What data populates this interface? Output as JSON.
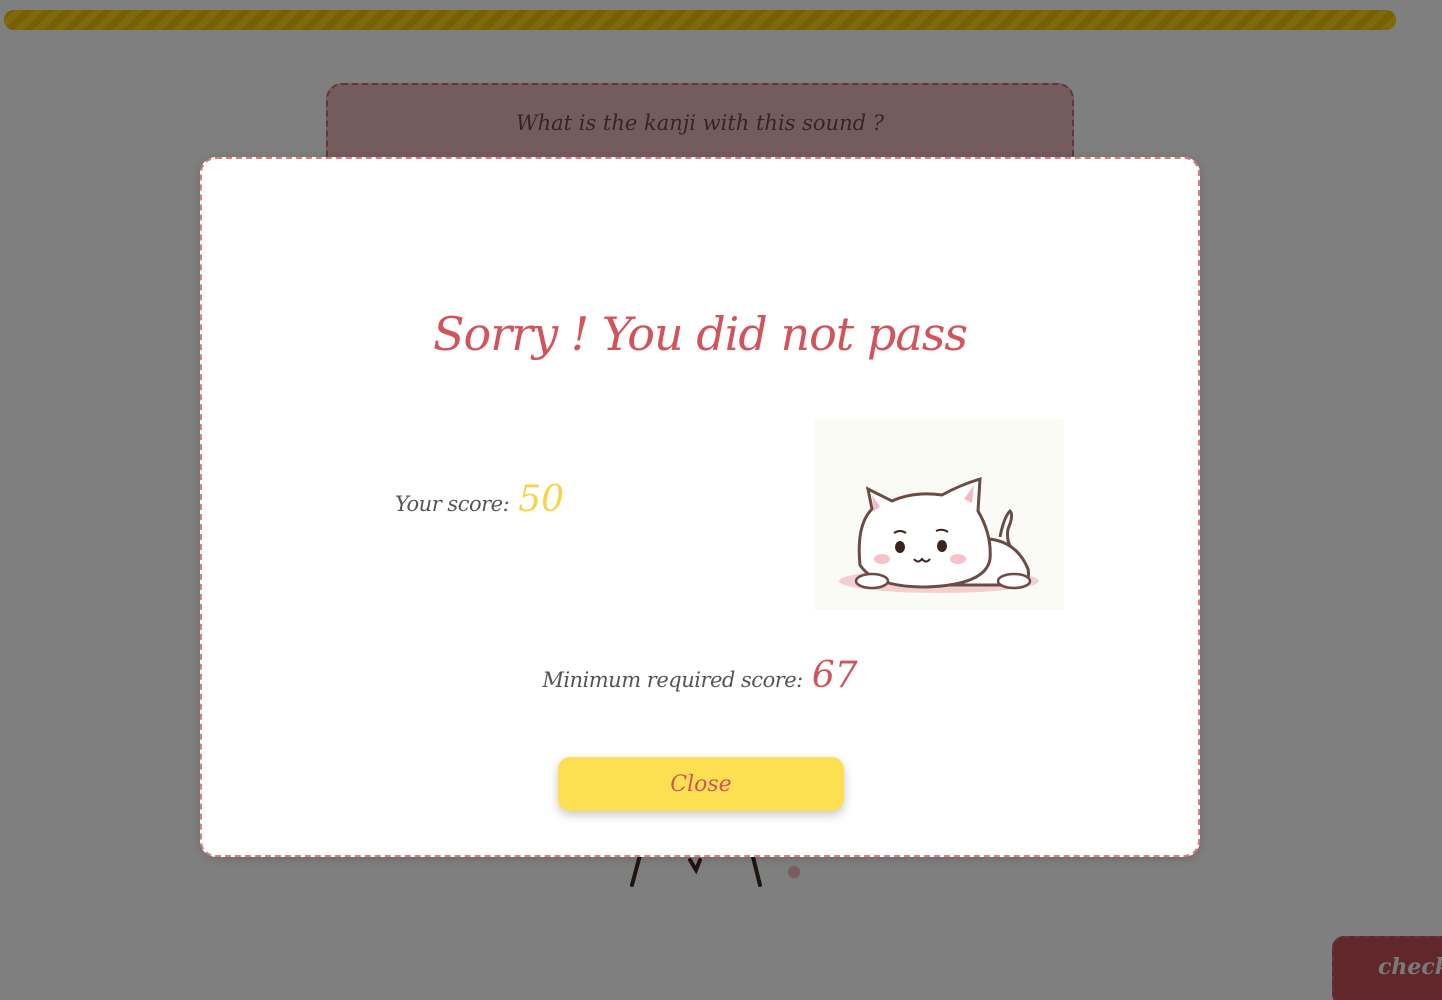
{
  "progress": {
    "value": 1.0,
    "color": "#f3c400"
  },
  "question": {
    "prompt": "What is the kanji with this sound ?"
  },
  "check_button": {
    "label": "check"
  },
  "result_modal": {
    "title": "Sorry ! You did not pass",
    "score_label": "Your score:",
    "score_value": "50",
    "min_label": "Minimum required score:",
    "min_value": "67",
    "close_label": "Close",
    "image": "sad-cat-lying-down-icon"
  },
  "colors": {
    "accent_red": "#d1545b",
    "accent_yellow": "#fde052",
    "score_yellow": "#f6d545",
    "border_pink": "#e07b84"
  }
}
